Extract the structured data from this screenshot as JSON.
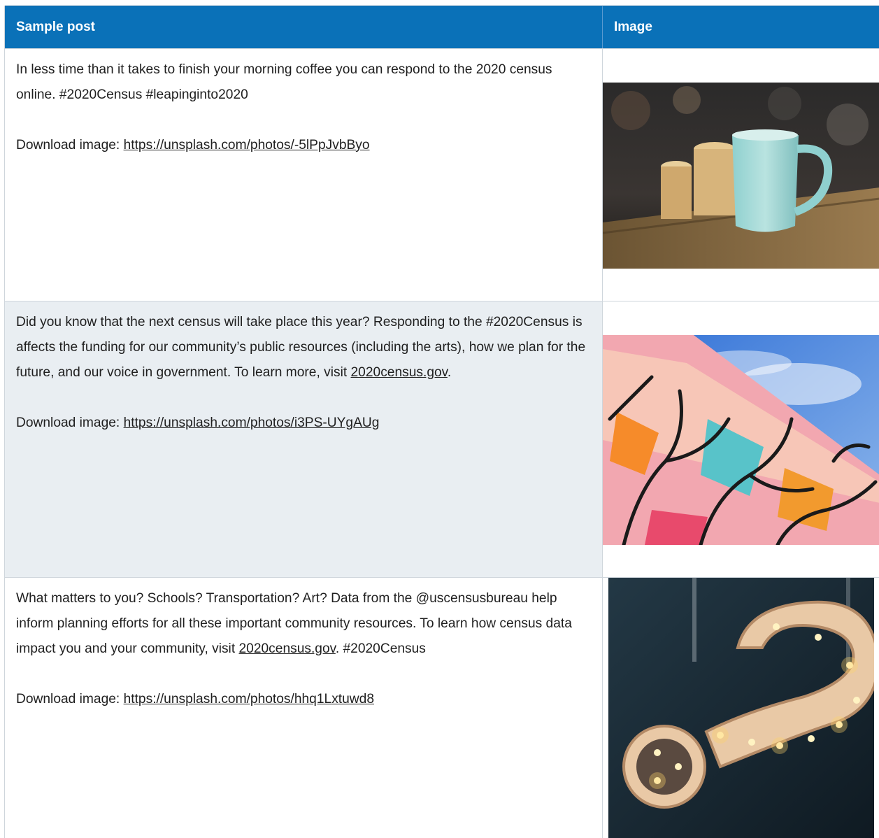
{
  "table": {
    "headers": {
      "post": "Sample post",
      "image": "Image"
    },
    "rows": [
      {
        "post_text": "In less time than it takes to finish your morning coffee you can respond to the 2020 census online. #2020Census #leapinginto2020",
        "download_label": "Download image: ",
        "download_link": "https://unsplash.com/photos/-5lPpJvbByo",
        "image_icon": "coffee-mug-photo"
      },
      {
        "post_text_before": "Did you know that the next census will take place this year? Responding to the #2020Census is affects the funding for our community’s public resources (including the arts), how we plan for the future, and our voice in government. To learn more, visit ",
        "post_link": "2020census.gov",
        "post_text_after": ".",
        "download_label": "Download image: ",
        "download_link": "https://unsplash.com/photos/i3PS-UYgAUg",
        "image_icon": "mural-photo"
      },
      {
        "post_text_before": "What matters to you? Schools? Transportation? Art? Data from the @uscensusbureau help inform planning efforts for all these important community resources. To learn how census data impact you and your community, visit ",
        "post_link": "2020census.gov",
        "post_text_after": ". #2020Census",
        "download_label": "Download image: ",
        "download_link": "https://unsplash.com/photos/hhq1Lxtuwd8",
        "image_icon": "question-mark-marquee-photo"
      }
    ]
  },
  "colors": {
    "header_bg": "#0a71b8",
    "alt_row_bg": "#e9eef2",
    "border": "#cfd6dc"
  }
}
